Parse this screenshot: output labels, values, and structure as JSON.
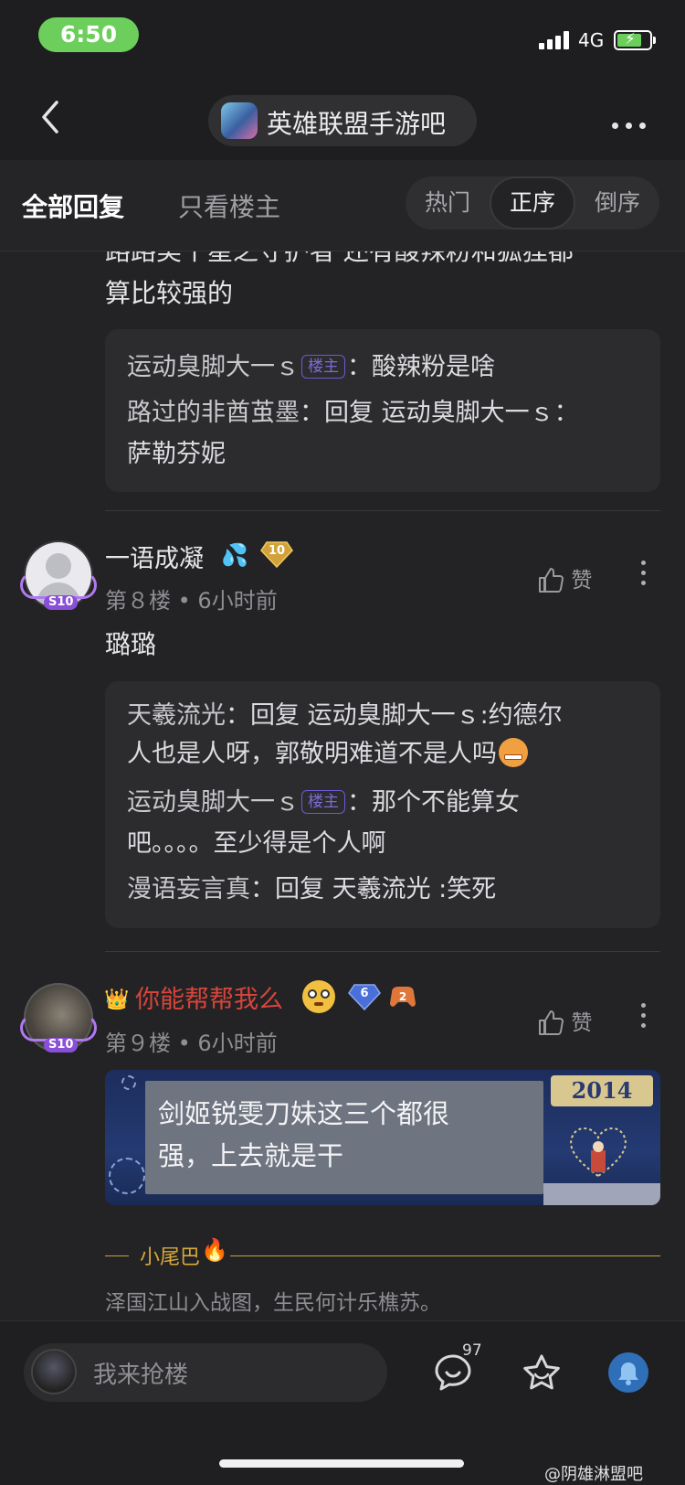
{
  "status_bar": {
    "time": "6:50",
    "network": "4G"
  },
  "header": {
    "forum_name": "英雄联盟手游吧"
  },
  "tabs": {
    "all_replies": "全部回复",
    "only_op": "只看楼主",
    "sort_hot": "热门",
    "sort_asc": "正序",
    "sort_desc": "倒序"
  },
  "post7": {
    "partial_line": "路路美丫星之守护者 还有酸辣粉和狐狸都",
    "line2": "算比较强的",
    "replies": [
      {
        "user": "运动臭脚大一ｓ",
        "op_badge": "楼主",
        "sep": "：",
        "text": "酸辣粉是啥"
      },
      {
        "user": "路过的非酋茧墨",
        "sep": "：",
        "text": "回复  运动臭脚大一ｓ："
      },
      {
        "text": "萨勒芬妮"
      }
    ]
  },
  "post8": {
    "username": "一语成凝",
    "level": "10",
    "badge": "S10",
    "floor": "第８楼",
    "time": "6小时前",
    "like_label": "赞",
    "content": "璐璐",
    "replies": [
      {
        "user": "天羲流光",
        "sep": "：",
        "text": "回复  运动臭脚大一ｓ:约德尔"
      },
      {
        "text": "人也是人呀，郭敬明难道不是人吗"
      },
      {
        "user": "运动臭脚大一ｓ",
        "op_badge": "楼主",
        "sep": "：",
        "text": "那个不能算女"
      },
      {
        "text": "吧。。。。至少得是个人啊"
      },
      {
        "user": "漫语妄言真",
        "sep": "：",
        "text": "回复 天羲流光 :笑死"
      }
    ]
  },
  "post9": {
    "username": "你能帮帮我么",
    "level": "6",
    "badge": "S10",
    "floor": "第９楼",
    "time": "6小时前",
    "like_label": "赞",
    "bubble_text_1": "剑姬锐雯刀妹这三个都很",
    "bubble_text_2": "强，上去就是干",
    "bubble_year": "2014",
    "tail_label": "小尾巴",
    "signature": "泽国江山入战图，生民何计乐樵苏。"
  },
  "bottom": {
    "input_placeholder": "我来抢楼",
    "comment_count": "97"
  },
  "watermark": "@阴雄淋盟吧",
  "colors": {
    "accent_red": "#d8453a",
    "op_badge": "#6d5ad0",
    "gold": "#d2a23a",
    "time_pill": "#6ccf5c"
  }
}
